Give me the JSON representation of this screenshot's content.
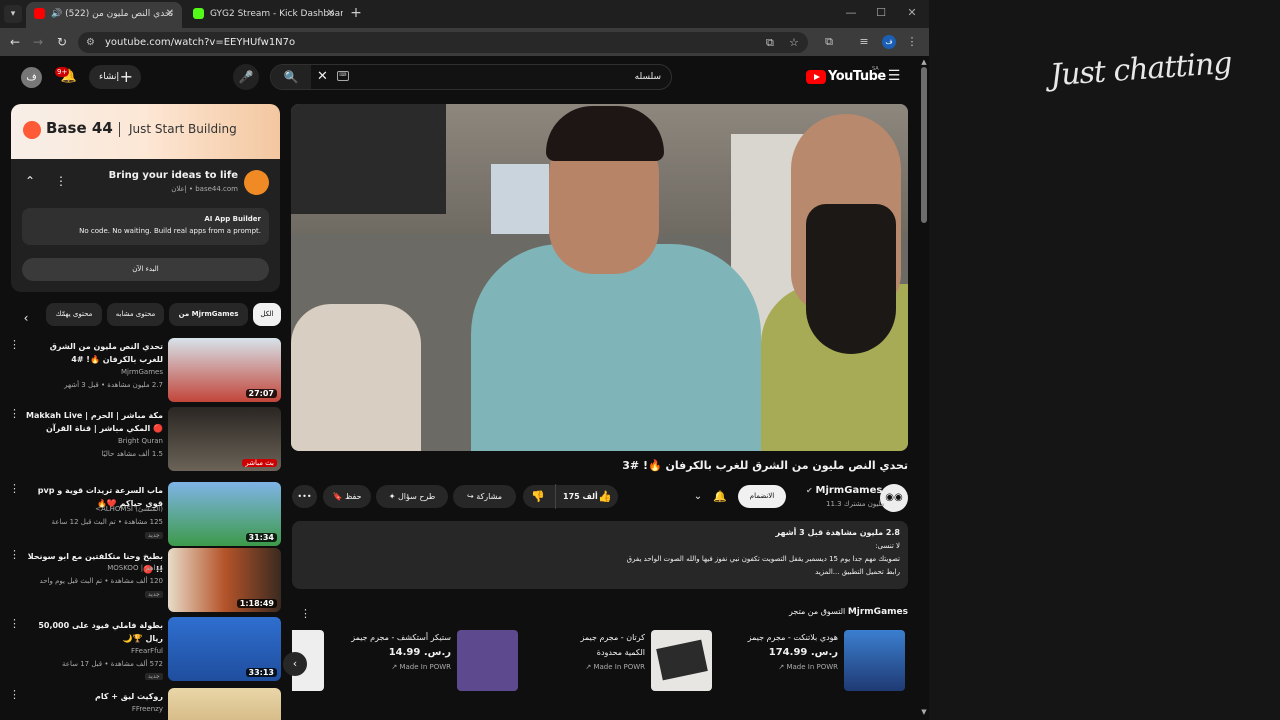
{
  "browser": {
    "tabs": [
      {
        "title": "(522) تحدي النص مليون من",
        "favicon_color": "#ff0000",
        "muted_icon": "speaker-icon"
      },
      {
        "title": "GYG2 Stream - Kick Dashboard",
        "favicon_color": "#53fc18"
      }
    ],
    "url": "youtube.com/watch?v=EEYHUfw1N7o",
    "profile_initial": "ف"
  },
  "youtube": {
    "logo_text": "YouTube",
    "region": "SA",
    "search_query": "سلسله",
    "create_label": "إنشاء",
    "notif_count": "9+",
    "user_initial": "ف"
  },
  "video": {
    "title": "تحدي النص مليون من الشرق للغرب بالكرفان 🔥! #3",
    "channel": "MjrmGames",
    "subscribers": "11.3 مليون مشترك",
    "join_label": "الانضمام",
    "likes": "175 ألف",
    "share_label": "مشاركة",
    "ask_label": "طرح سؤال",
    "save_label": "حفظ",
    "description": {
      "stats": "2.8 مليون مشاهدة قبل 3 أشهر",
      "line1": "لا تنسى:",
      "line2": "تصويتك مهم جدا يوم 15 ديسمبر يقفل التصويت تكفون نبي نفوز فيها والله الصوت الواحد يفرق",
      "line3": "رابط تحميل التطبيق",
      "more": "...المزيد"
    }
  },
  "shopping": {
    "title_prefix": "التسوق من متجر",
    "channel": "MjrmGames",
    "products": [
      {
        "name": "هودي بلاتنكت - مجرم جيمز",
        "price": "ر.س. 174.99",
        "source": "Made In POWR"
      },
      {
        "name": "كرتان - مجرم جيمز",
        "price": "الكمية محدودة",
        "source": "Made In POWR"
      },
      {
        "name": "ستيكر أستكشف - مجرم جيمز",
        "price": "ر.س. 14.99",
        "source": "Made In POWR"
      }
    ]
  },
  "ad": {
    "brand": "Base 44",
    "tagline": "Just Start Building",
    "title": "Bring your ideas to life",
    "sponsor": "إعلان • base44.com",
    "box_title": "AI App Builder",
    "box_text": "No code. No waiting. Build real apps from a prompt.",
    "cta": "البدء الآن"
  },
  "chips": [
    "الكل",
    "من MjrmGames",
    "محتوى مشابه",
    "محتوى يهمّك"
  ],
  "related": [
    {
      "title": "تحدي النص مليون من الشرق للغرب بالكرفان 🔥! #4",
      "channel": "MjrmGames",
      "meta": "2.7 مليون مشاهدة • قبل 3 أشهر",
      "duration": "27:07",
      "thumb": "#c2453a"
    },
    {
      "title": "مكة مباشر | الحرم | Makkah Live 🔴 المكي مباشر | قناة القرآن الكريم السعودية ...",
      "channel": "Bright Quran",
      "meta": "1.5 ألف مشاهد حاليًا",
      "duration": "بث مباشر",
      "thumb": "#4a4640",
      "live": true
    },
    {
      "title": "ماب السرعة تريدات قوية و pvp قوي حياكم ❤️🔥",
      "channel": "(المنشئ) ALHOMSI>",
      "meta": "125 مشاهدة • تم البث قبل 12 ساعة",
      "duration": "31:34",
      "thumb": "#4a7fc2",
      "new": "جديد"
    },
    {
      "title": "بطبخ وحنا متكلفتين مع ابو سونحلا !! 🔴",
      "channel": "مُداهم | MOSKOO",
      "meta": "120 ألف مشاهدة • تم البث قبل يوم واحد",
      "duration": "1:18:49",
      "thumb": "#b5542a",
      "new": "جديد"
    },
    {
      "title": "بطولة فاملي فيود على 50,000 ريال 🏆🌙",
      "channel": "FFearFful",
      "meta": "572 ألف مشاهدة • قبل 17 ساعة",
      "duration": "33:13",
      "thumb": "#1f4e9e",
      "new": "جديد"
    },
    {
      "title": "روكيت ليق + كام",
      "channel": "FFreenzy",
      "meta": "",
      "duration": "",
      "thumb": "#c6a46a"
    }
  ],
  "stream_overlay": {
    "text": "Just chatting"
  }
}
